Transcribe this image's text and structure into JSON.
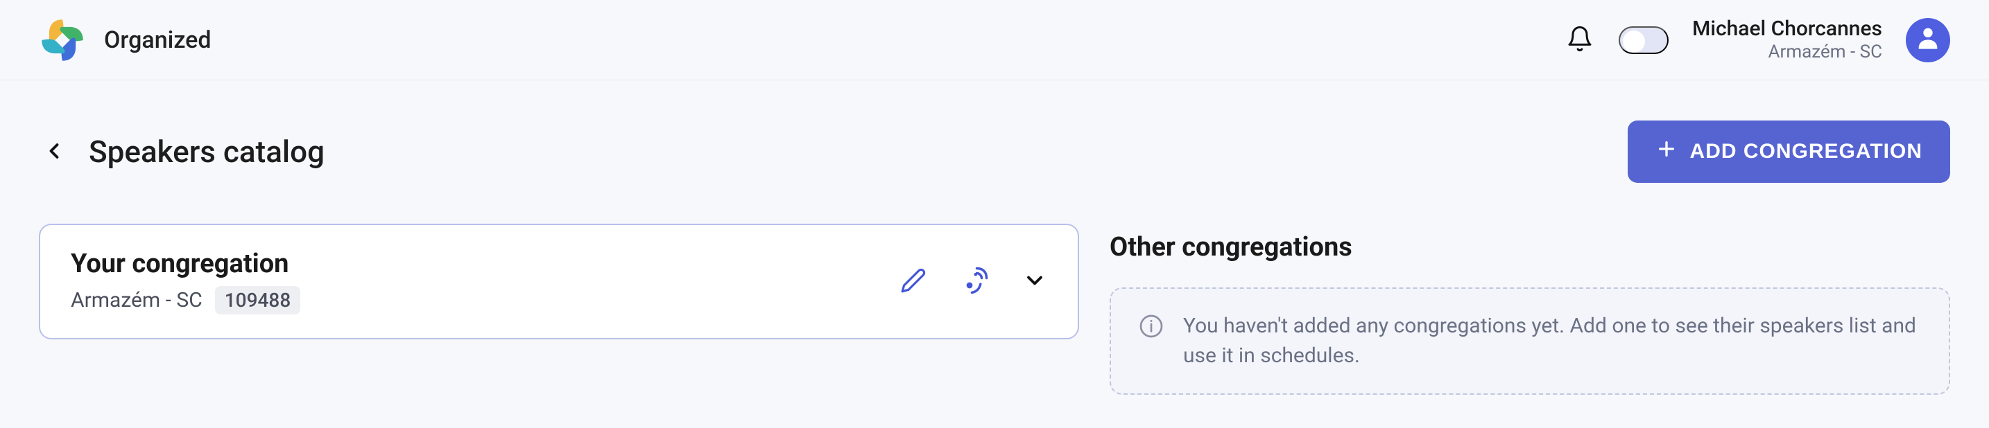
{
  "brand": {
    "name": "Organized"
  },
  "user": {
    "name": "Michael Chorcannes",
    "congregation": "Armazém - SC"
  },
  "page": {
    "title": "Speakers catalog",
    "add_button": "ADD CONGREGATION"
  },
  "your_congregation": {
    "heading": "Your congregation",
    "name": "Armazém - SC",
    "code": "109488"
  },
  "other": {
    "heading": "Other congregations",
    "empty_message": "You haven't added any congregations yet. Add one to see their speakers list and use it in schedules."
  }
}
